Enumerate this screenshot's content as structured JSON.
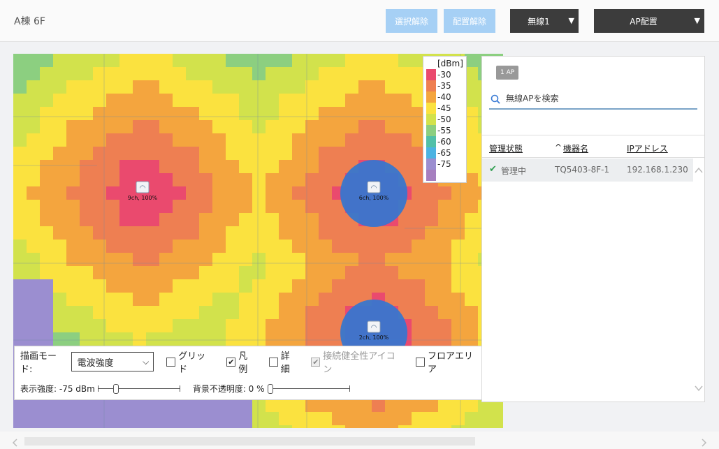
{
  "header": {
    "title": "A棟 6F",
    "deselect_label": "選択解除",
    "unplace_label": "配置解除",
    "radio_label": "無線1",
    "ap_place_label": "AP配置"
  },
  "map": {
    "aps": [
      {
        "label": "9ch, 100%"
      },
      {
        "label": "6ch, 100%"
      },
      {
        "label": "2ch, 100%"
      }
    ]
  },
  "legend": {
    "unit": "[dBm]",
    "items": [
      {
        "value": "-30",
        "color": "#ea4a6e"
      },
      {
        "value": "-35",
        "color": "#ee7f52"
      },
      {
        "value": "-40",
        "color": "#f4a53e"
      },
      {
        "value": "-45",
        "color": "#fbe23f"
      },
      {
        "value": "-50",
        "color": "#d2e24c"
      },
      {
        "value": "-55",
        "color": "#8ccf80"
      },
      {
        "value": "-60",
        "color": "#52c0a8"
      },
      {
        "value": "-65",
        "color": "#4cb3e2"
      },
      {
        "value": "-75",
        "color": "#9b8ed0"
      },
      {
        "value": "",
        "color": "#a67fbf"
      }
    ]
  },
  "controls": {
    "draw_mode_label": "描画モード:",
    "draw_mode_value": "電波強度",
    "grid_label": "グリッド",
    "grid_checked": false,
    "legend_label": "凡例",
    "legend_checked": true,
    "detail_label": "詳細",
    "detail_checked": false,
    "health_icon_label": "接続健全性アイコン",
    "health_icon_checked": true,
    "floor_area_label": "フロアエリア",
    "floor_area_checked": false,
    "strength_label": "表示強度: -75 dBm",
    "strength_level": 0.2,
    "opacity_label": "背景不透明度: 0 %",
    "opacity_level": 0.0
  },
  "panel": {
    "badge": "1 AP",
    "search_placeholder": "無線APを検索",
    "columns": [
      "管理状態",
      "機器名",
      "IPアドレス"
    ],
    "sort_indicator": "^",
    "rows": [
      {
        "status": "管理中",
        "name": "TQ5403-8F-1",
        "ip": "192.168.1.230"
      }
    ]
  },
  "colors": {
    "accent": "#3a7bd5",
    "managed_check": "#2e9e4f"
  }
}
